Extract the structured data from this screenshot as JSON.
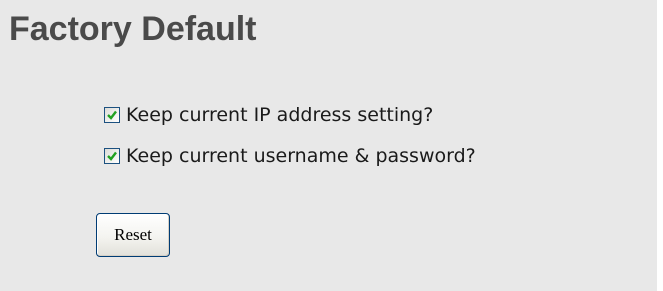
{
  "page": {
    "title": "Factory Default"
  },
  "options": {
    "keep_ip": {
      "label": "Keep current IP address setting?",
      "checked": true
    },
    "keep_credentials": {
      "label": "Keep current username & password?",
      "checked": true
    }
  },
  "actions": {
    "reset_label": "Reset"
  },
  "colors": {
    "panel_background": "#e8e8e8",
    "title_text": "#4a4a4a",
    "checkbox_border": "#1c5180",
    "checkmark": "#21a121",
    "button_border": "#003c74"
  }
}
